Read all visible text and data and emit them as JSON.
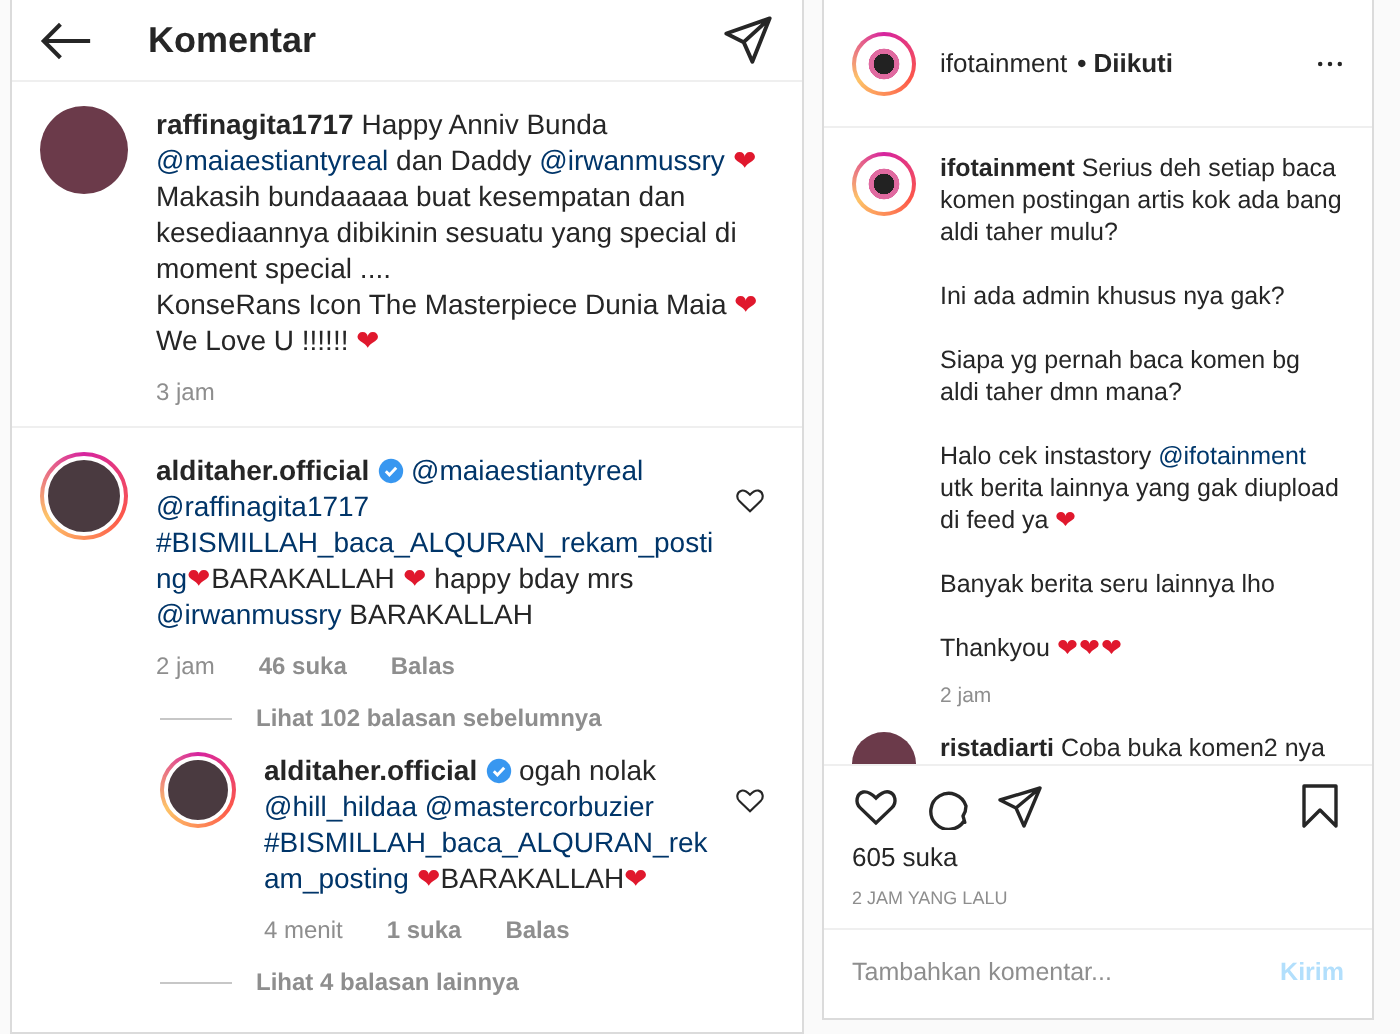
{
  "header": {
    "title": "Komentar"
  },
  "comments": [
    {
      "username": "raffinagita1717",
      "verified": false,
      "story_ring": false,
      "text": "Happy Anniv Bunda @maiaestiantyreal dan Daddy @irwanmussry ❤ Makasih bundaaaaa buat kesempatan dan kesediaannya dibikinin sesuatu yang special di moment special ....\nKonseRans Icon The Masterpiece Dunia Maia ❤ We Love U !!!!!! ❤",
      "time": "3 jam",
      "likeable": false
    },
    {
      "username": "alditaher.official",
      "verified": true,
      "story_ring": true,
      "text": "@maiaestiantyreal @raffinagita1717 #BISMILLAH_baca_ALQURAN_rekam_posting❤BARAKALLAH ❤ happy bday mrs @irwanmussry BARAKALLAH",
      "time": "2 jam",
      "likes": "46 suka",
      "reply": "Balas",
      "likeable": true,
      "view_previous": "Lihat 102 balasan sebelumnya",
      "replies": [
        {
          "username": "alditaher.official",
          "verified": true,
          "story_ring": true,
          "text": "ogah nolak @hill_hildaa @mastercorbuzier #BISMILLAH_baca_ALQURAN_rekam_posting ❤BARAKALLAH❤",
          "time": "4 menit",
          "likes": "1 suka",
          "reply": "Balas",
          "likeable": true
        }
      ],
      "view_more": "Lihat 4 balasan lainnya"
    }
  ],
  "post": {
    "username": "ifotainment",
    "follow_status": "• Diikuti",
    "caption": {
      "username": "ifotainment",
      "text": "Serius deh setiap baca komen postingan artis kok ada bang aldi taher mulu?\n\nIni ada admin khusus nya gak?\n\nSiapa yg pernah baca komen bg aldi taher dmn mana?\n\nHalo cek instastory @ifotainment utk berita lainnya yang gak diupload di feed ya ❤\n\nBanyak berita seru lainnya lho\n\nThankyou ❤❤❤",
      "time": "2 jam"
    },
    "next_comment": {
      "username": "ristadiarti",
      "text": "Coba buka komen2 nya"
    },
    "likes": "605 suka",
    "time": "2 JAM YANG LALU",
    "input": {
      "placeholder": "Tambahkan komentar..."
    },
    "submit": {
      "label": "Kirim",
      "disabled": true
    }
  }
}
